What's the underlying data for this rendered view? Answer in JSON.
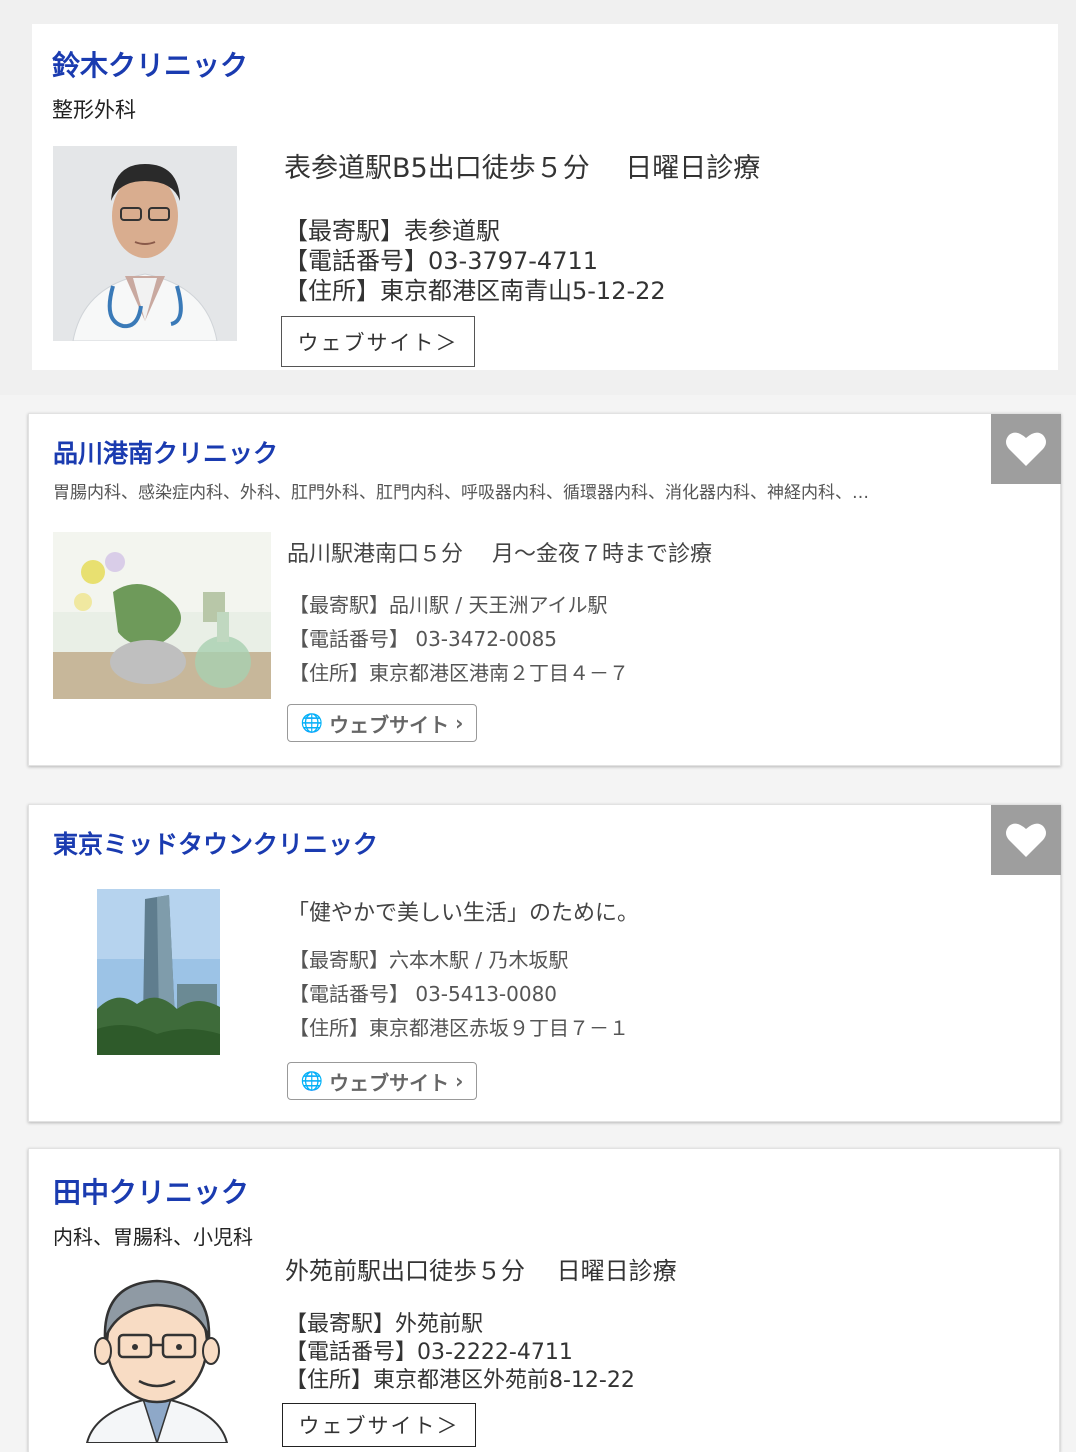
{
  "clinics": [
    {
      "name": "鈴木クリニック",
      "specialty": "整形外科",
      "tagline": "表参道駅B5出口徒歩５分　 日曜日診療",
      "station": "【最寄駅】表参道駅",
      "phone": "【電話番号】03-3797-4711",
      "address": "【住所】東京都港区南青山5-12-22",
      "website_button": "ウェブサイト＞",
      "photo": "doctor-photo"
    },
    {
      "name": "品川港南クリニック",
      "specialty": "胃腸内科、感染症内科、外科、肛門外科、肛門内科、呼吸器内科、循環器内科、消化器内科、神経内科、…",
      "tagline": "品川駅港南口５分　 月～金夜７時まで診療",
      "station": "【最寄駅】品川駅 / 天王洲アイル駅",
      "phone": "【電話番号】 03-3472-0085",
      "address": "【住所】東京都港区港南２丁目４－７",
      "website_button": "ウェブサイト",
      "favorite_icon": "heart-icon",
      "photo": "flowers-photo"
    },
    {
      "name": "東京ミッドタウンクリニック",
      "tagline": "「健やかで美しい生活」のために。",
      "station": "【最寄駅】六本木駅 / 乃木坂駅",
      "phone": "【電話番号】 03-5413-0080",
      "address": "【住所】東京都港区赤坂９丁目７－１",
      "website_button": "ウェブサイト",
      "favorite_icon": "heart-icon",
      "photo": "building-photo"
    },
    {
      "name": "田中クリニック",
      "specialty": "内科、胃腸科、小児科",
      "tagline": "外苑前駅出口徒歩５分　 日曜日診療",
      "station": "【最寄駅】外苑前駅",
      "phone": "【電話番号】03-2222-4711",
      "address": "【住所】東京都港区外苑前8-12-22",
      "website_button": "ウェブサイト＞",
      "photo": "doctor-illustration"
    }
  ],
  "colors": {
    "name": "#1a3bb0",
    "favorite_bg": "#9e9e9e"
  }
}
